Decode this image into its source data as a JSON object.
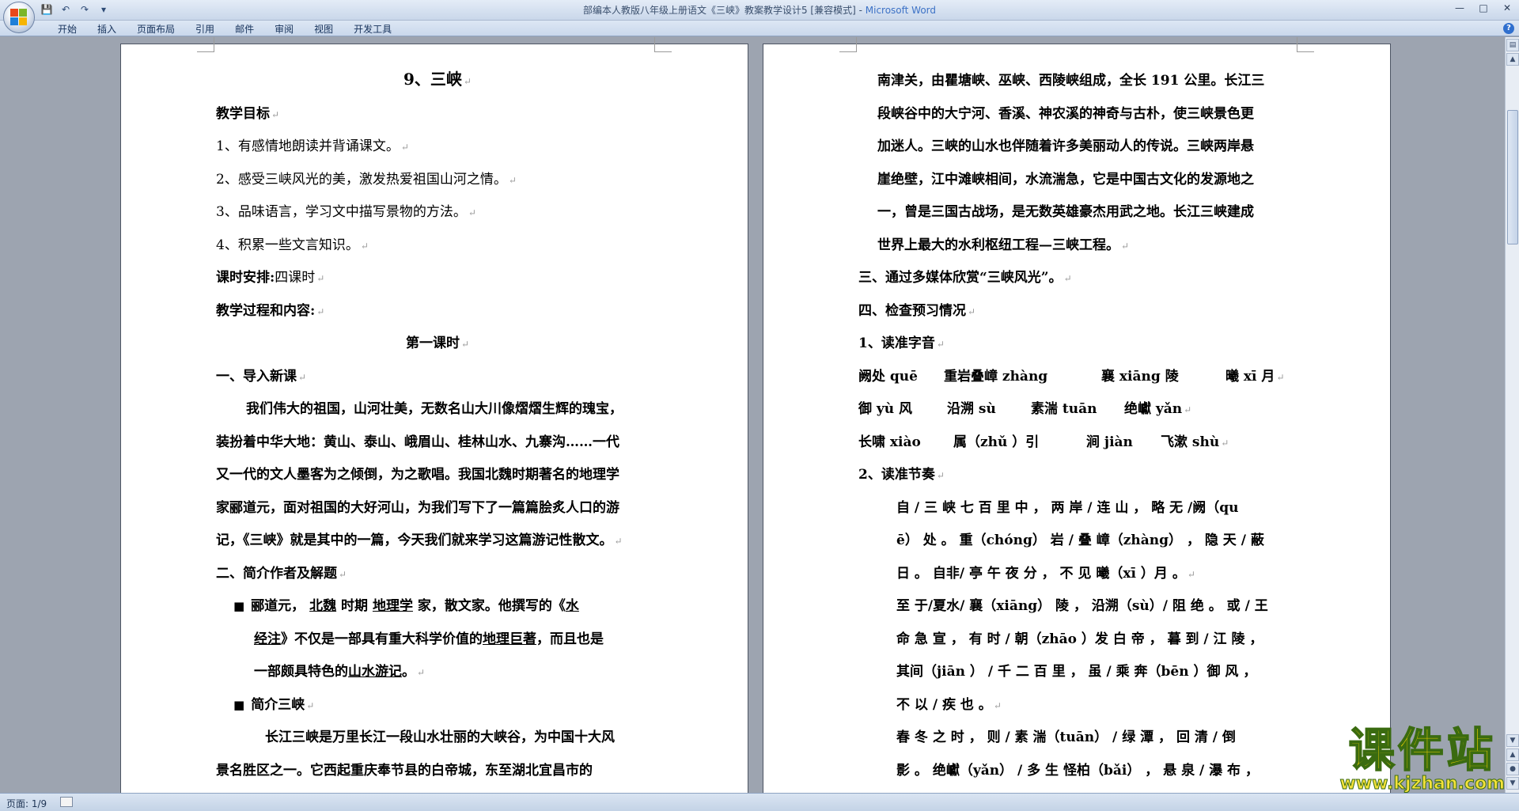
{
  "window": {
    "title": "部编本人教版八年级上册语文《三峡》教案教学设计5 [兼容模式]",
    "app": "Microsoft Word",
    "app_separator": " - "
  },
  "qat": {
    "save": "💾",
    "undo": "↶",
    "redo": "↷",
    "more": "▾"
  },
  "ribbon": {
    "tabs": [
      "开始",
      "插入",
      "页面布局",
      "引用",
      "邮件",
      "审阅",
      "视图",
      "开发工具"
    ]
  },
  "status": {
    "page": "页面: 1/9"
  },
  "page1": {
    "title": "9、三峡",
    "goals_heading": "教学目标",
    "goals": [
      "1、有感情地朗读并背诵课文。",
      "2、感受三峡风光的美，激发热爱祖国山河之情。",
      "3、品味语言，学习文中描写景物的方法。",
      "4、积累一些文言知识。"
    ],
    "schedule_label": "课时安排:",
    "schedule_value": "四课时",
    "process_heading": "教学过程和内容:",
    "lesson_heading": "第一课时",
    "section1": "一、导入新课",
    "para1": [
      "我们伟大的祖国，山河壮美，无数名山大川像熠熠生辉的瑰宝，",
      "装扮着中华大地：黄山、泰山、峨眉山、桂林山水、九寨沟……一代",
      "又一代的文人墨客为之倾倒，为之歌唱。我国北魏时期著名的地理学",
      "家郦道元，面对祖国的大好河山，为我们写下了一篇篇脍炙人口的游",
      "记，《三峡》就是其中的一篇，今天我们就来学习这篇游记性散文。"
    ],
    "section2": "二、简介作者及解题",
    "bullet_mark": "■",
    "author": {
      "l1_a": "郦道元，",
      "l1_b": "北魏",
      "l1_c": "时期",
      "l1_d": "地理学",
      "l1_e": "家，散文家。他撰写的《",
      "l1_f": "水",
      "l2_a": "经注",
      "l2_b": "》不仅是一部具有重大科学价值的",
      "l2_c": "地理巨著",
      "l2_d": "，而且也是",
      "l3_a": "一部颇具特色的",
      "l3_b": "山水游记",
      "l3_c": "。"
    },
    "intro_heading": "简介三峡",
    "intro_lines": [
      "长江三峡是万里长江一段山水壮丽的大峡谷，为中国十大风",
      "景名胜区之一。它西起重庆奉节县的白帝城，东至湖北宜昌市的"
    ]
  },
  "page2": {
    "cont_lines": [
      "南津关，由瞿塘峡、巫峡、西陵峡组成，全长 191 公里。长江三",
      "段峡谷中的大宁河、香溪、神农溪的神奇与古朴，使三峡景色更",
      "加迷人。三峡的山水也伴随着许多美丽动人的传说。三峡两岸悬",
      "崖绝壁，江中滩峡相间，水流湍急，它是中国古文化的发源地之",
      "一，曾是三国古战场，是无数英雄豪杰用武之地。长江三峡建成",
      "世界上最大的水利枢纽工程—三峡工程。"
    ],
    "section3": "三、通过多媒体欣赏“三峡风光”。",
    "section4": "四、检查预习情况",
    "sub1": "1、读准字音",
    "pron_row1": [
      "阙处 quē",
      "重岩叠嶂 zhàng",
      "襄 xiāng 陵",
      "曦 xī 月"
    ],
    "pron_row2": [
      "御 yù 风",
      "沿溯 sù",
      "素湍 tuān",
      "绝巘 yǎn"
    ],
    "pron_row3": [
      "长啸 xiào",
      "属（zhǔ ）引",
      "涧 jiàn",
      "飞漱 shù"
    ],
    "sub2": "2、读准节奏",
    "rhythm": [
      "自 / 三 峡 七 百 里 中 ， 两 岸 / 连 山 ， 略 无 /阙（qu",
      "ē） 处 。 重（chóng） 岩 / 叠 嶂（zhàng） ， 隐 天 / 蔽",
      "日 。 自非/ 亭 午 夜 分 ， 不 见 曦（xī ）月 。",
      "至 于/夏水/ 襄（xiāng） 陵 ， 沿溯（sù）/ 阻 绝 。 或 / 王",
      "命 急 宣 ， 有 时 / 朝（zhāo ）发 白 帝 ， 暮 到 / 江 陵 ，",
      "其间（jiān ） / 千 二 百 里 ， 虽 / 乘 奔（bēn ）御 风 ，",
      "不 以 / 疾 也 。",
      "春 冬 之 时 ， 则 / 素 湍（tuān） / 绿 潭 ， 回 清 / 倒",
      "影 。 绝巘（yǎn） / 多 生 怪柏（bǎi） ， 悬 泉 / 瀑 布 ，"
    ]
  },
  "para_mark": "↵",
  "watermark": {
    "title": "课件站",
    "url": "www.kjzhan.com"
  }
}
